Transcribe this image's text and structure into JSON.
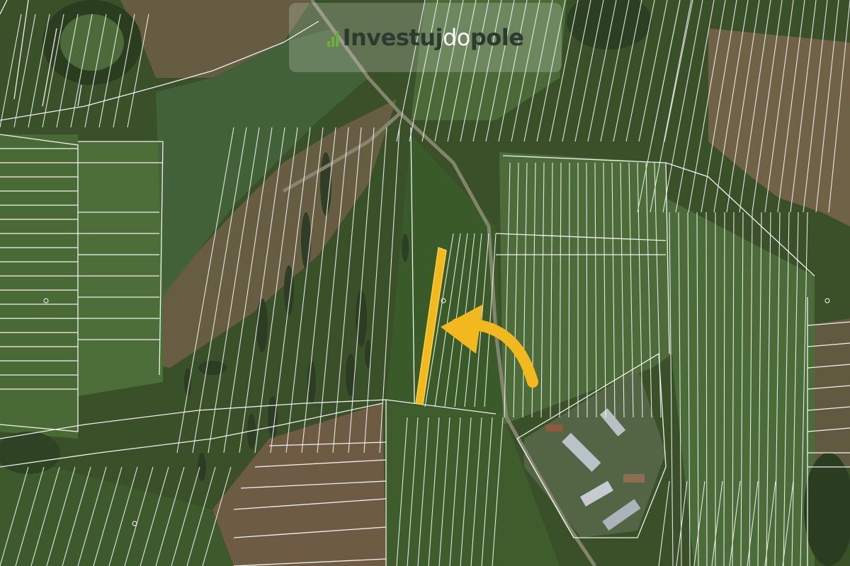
{
  "logo": {
    "part1": "Investuj",
    "part2": "do",
    "part3": "pole",
    "bar_color": "#6fae3a"
  },
  "map": {
    "highlight_color": "#f2b91f",
    "parcel_line_color": "#ffffff",
    "arrow_color": "#f2b91f"
  }
}
